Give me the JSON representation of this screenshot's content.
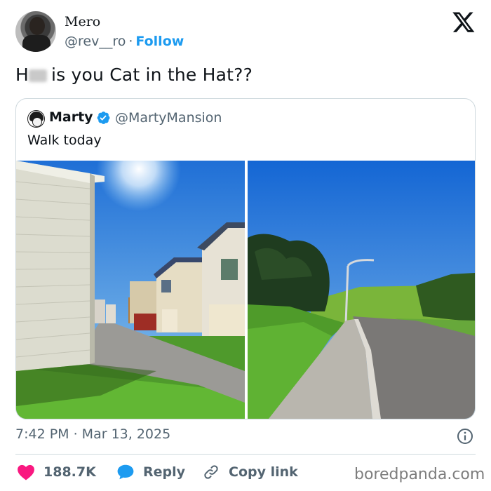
{
  "author": {
    "display_name": "Mero",
    "handle": "@rev__ro",
    "separator": "·",
    "follow_label": "Follow"
  },
  "tweet": {
    "text_prefix": "H",
    "text_suffix": "is you Cat in the Hat??"
  },
  "quoted": {
    "display_name": "Marty",
    "handle": "@MartyMansion",
    "text": "Walk today"
  },
  "meta": {
    "timestamp": "7:42 PM · Mar 13, 2025"
  },
  "actions": {
    "like_count": "188.7K",
    "reply_label": "Reply",
    "copy_label": "Copy link"
  },
  "watermark": "boredpanda.com",
  "icons": {
    "x_logo": "x-logo-icon",
    "verified": "verified-badge-icon",
    "info": "info-icon",
    "heart": "heart-icon",
    "reply": "reply-bubble-icon",
    "link": "link-icon"
  },
  "colors": {
    "accent": "#1d9bf0",
    "like": "#f91880",
    "muted": "#536471",
    "text": "#0f1419",
    "border": "#cfd9de"
  }
}
